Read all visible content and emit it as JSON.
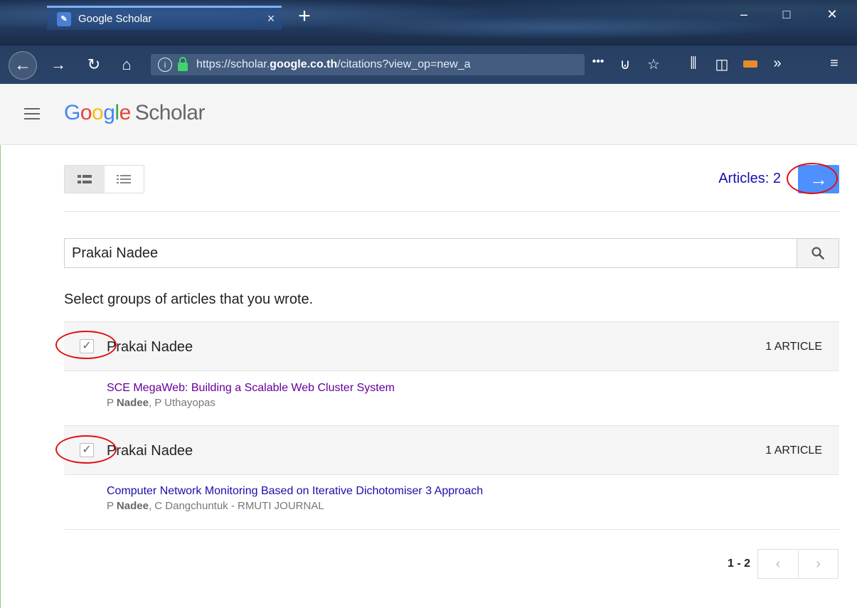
{
  "browser": {
    "tab_title": "Google Scholar",
    "tab_close": "×",
    "new_tab": "+",
    "url_prefix": "https://scholar.",
    "url_domain": "google.co.th",
    "url_suffix": "/citations?view_op=new_a",
    "page_actions": "•••",
    "window": {
      "minimize": "–",
      "maximize": "□",
      "close": "✕"
    }
  },
  "header": {
    "logo_google": "Google",
    "logo_product": "Scholar"
  },
  "toolbar": {
    "articles_label": "Articles: 2",
    "next_arrow": "→"
  },
  "search": {
    "value": "Prakai Nadee"
  },
  "prompt": "Select groups of articles that you wrote.",
  "groups": [
    {
      "name": "Prakai Nadee",
      "count": "1 ARTICLE",
      "checked": true,
      "article_title": "SCE MegaWeb: Building a Scalable Web Cluster System",
      "author_first": "P ",
      "author_bold": "Nadee",
      "author_rest": ", P Uthayopas"
    },
    {
      "name": "Prakai Nadee",
      "count": "1 ARTICLE",
      "checked": true,
      "article_title": "Computer Network Monitoring Based on Iterative Dichotomiser 3 Approach",
      "author_first": "P ",
      "author_bold": "Nadee",
      "author_rest": ", C Dangchuntuk - RMUTI JOURNAL"
    }
  ],
  "pagination": {
    "range": "1 - 2",
    "prev": "‹",
    "next": "›"
  },
  "colors": {
    "accent": "#4d90fe",
    "link": "#1a0dab",
    "visited": "#660099",
    "annotation": "#e01010"
  }
}
